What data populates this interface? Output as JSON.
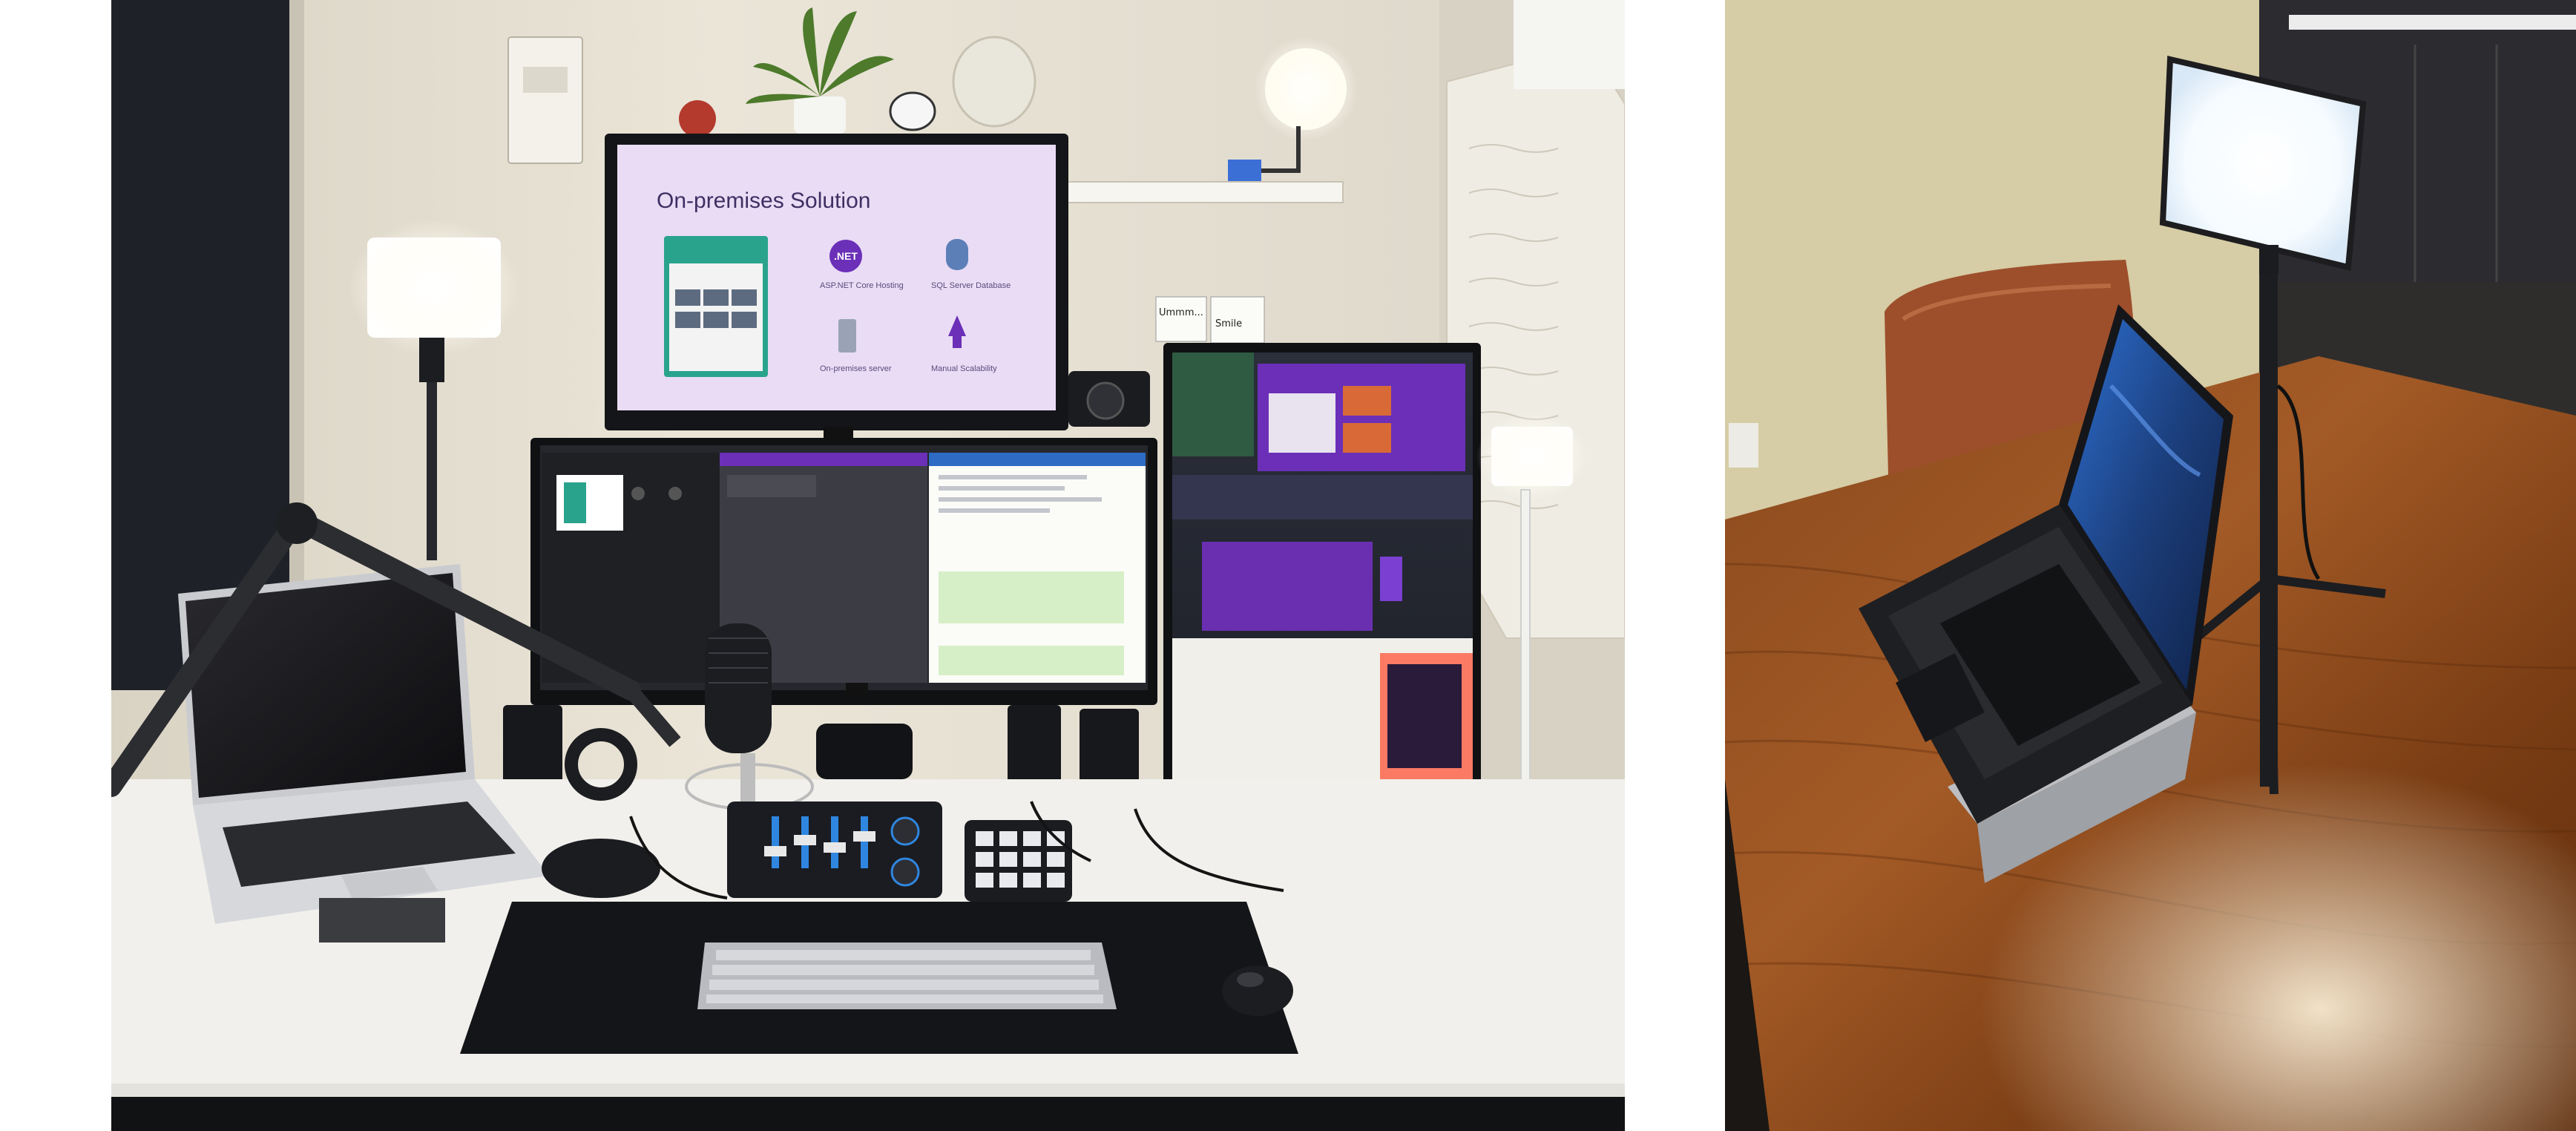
{
  "photos": {
    "left": {
      "subject": "desk setup with monitors, microphone, stream deck, lights"
    },
    "right": {
      "subject": "laptop on stand on wooden table with LED light"
    }
  },
  "slide": {
    "title": "On-premises Solution",
    "captions": [
      {
        "label": "ASP.NET Core Hosting"
      },
      {
        "label": "SQL Server Database"
      },
      {
        "label": "On-premises server"
      },
      {
        "label": "Manual Scalability"
      }
    ],
    "dotnet_badge": ".NET"
  },
  "sticky_notes": {
    "left": "Ummm...",
    "right": "Smile"
  },
  "colors": {
    "wall": "#e9e3d6",
    "desk": "#f1f0ec",
    "slide_bg": "#eadcf5",
    "accent_purple": "#6b2fb8",
    "led_glow": "#fffdf2",
    "wood": "#8a4a1c"
  }
}
